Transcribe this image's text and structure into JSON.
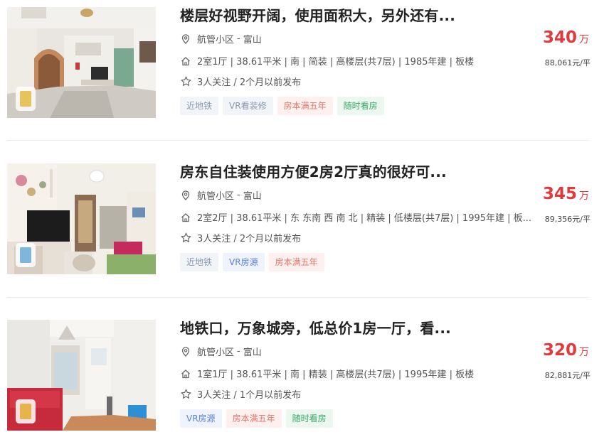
{
  "listings": [
    {
      "title": "楼层好视野开阔，使用面积大，另外还有...",
      "community": "航管小区",
      "separator": "-",
      "district": "富山",
      "info": "2室1厅 | 38.61平米 | 南 | 简装 | 高楼层(共7层) | 1985年建 | 板楼",
      "follow": "3人关注 / 2个月以前发布",
      "tags": [
        {
          "label": "近地铁",
          "style": "gray"
        },
        {
          "label": "VR看装修",
          "style": "gray"
        },
        {
          "label": "房本满五年",
          "style": "red"
        },
        {
          "label": "随时看房",
          "style": "green"
        }
      ],
      "price": "340",
      "price_unit": "万",
      "unit_price": "88,061元/平"
    },
    {
      "title": "房东自住装使用方便2房2厅真的很好可...",
      "community": "航管小区",
      "separator": "-",
      "district": "富山",
      "info": "2室2厅 | 38.61平米 | 东 东南 西 南 北 | 精装 | 低楼层(共7层) | 1995年建 | 板...",
      "follow": "3人关注 / 2个月以前发布",
      "tags": [
        {
          "label": "近地铁",
          "style": "gray"
        },
        {
          "label": "VR房源",
          "style": "blue"
        },
        {
          "label": "房本满五年",
          "style": "red"
        }
      ],
      "price": "345",
      "price_unit": "万",
      "unit_price": "89,356元/平"
    },
    {
      "title": "地铁口，万象城旁，低总价1房一厅，看...",
      "community": "航管小区",
      "separator": "-",
      "district": "富山",
      "info": "1室1厅 | 38.61平米 | 南 | 精装 | 高楼层(共7层) | 1995年建 | 板楼",
      "follow": "3人关注 / 1个月以前发布",
      "tags": [
        {
          "label": "VR房源",
          "style": "blue"
        },
        {
          "label": "房本满五年",
          "style": "red"
        },
        {
          "label": "随时看房",
          "style": "green"
        }
      ],
      "price": "320",
      "price_unit": "万",
      "unit_price": "82,881元/平"
    }
  ],
  "icons": {
    "location": "location-pin-icon",
    "house": "house-icon",
    "star": "star-icon",
    "vr": "vr-badge-icon"
  },
  "colors": {
    "price": "#e4393c",
    "title": "#222222",
    "meta": "#555555"
  }
}
